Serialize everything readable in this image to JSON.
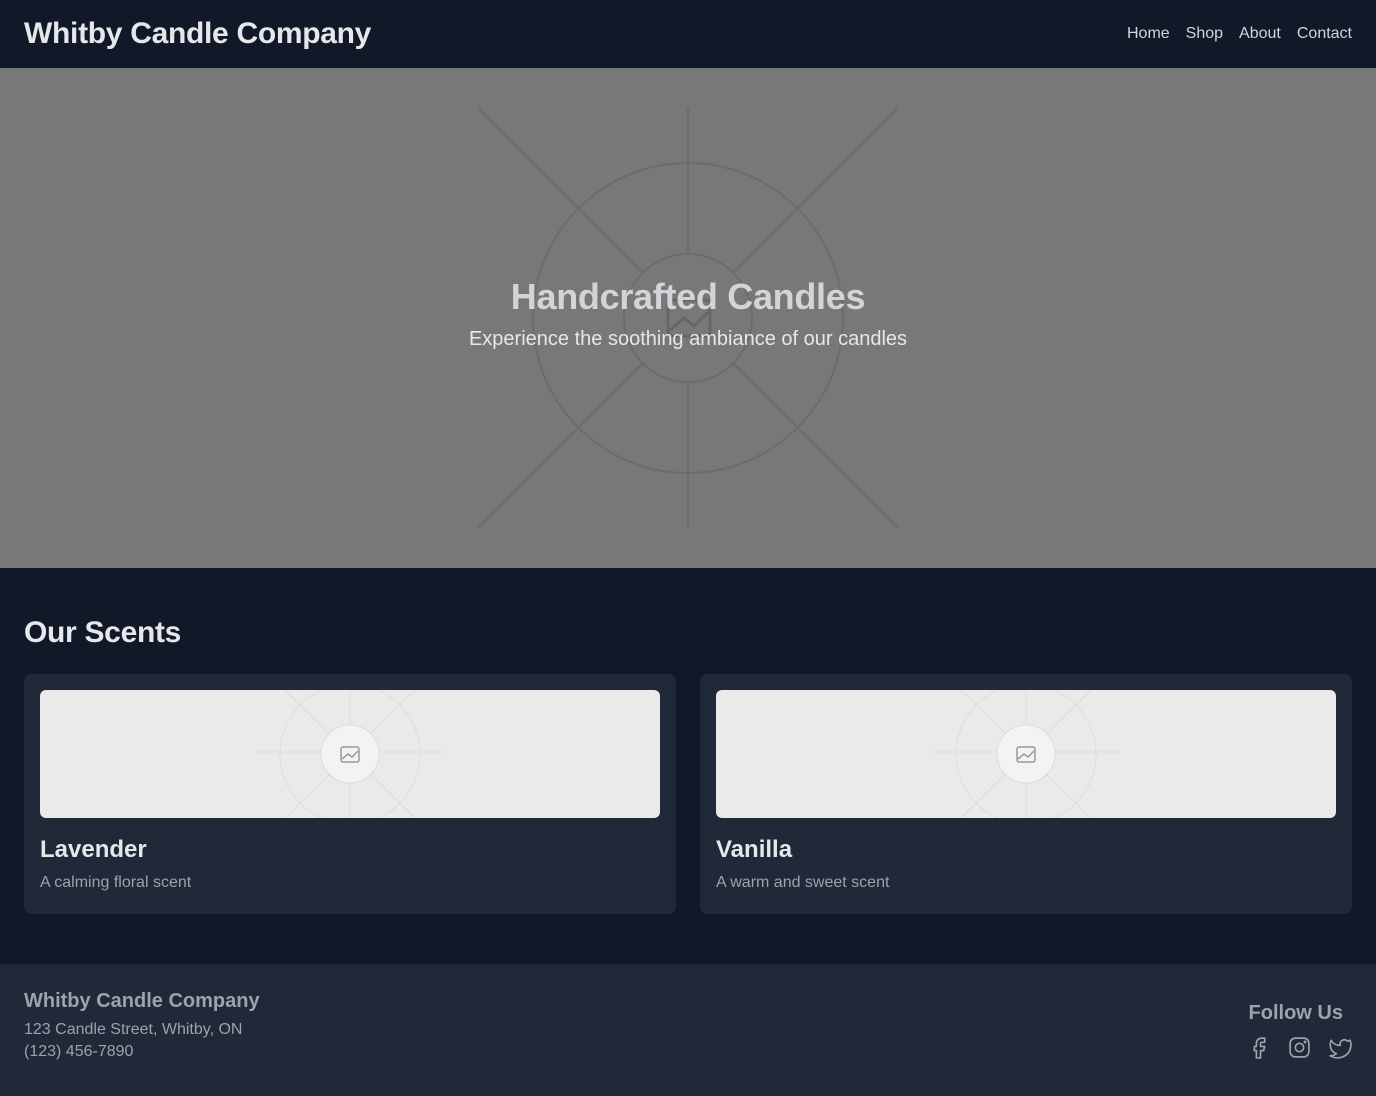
{
  "header": {
    "brand": "Whitby Candle Company",
    "nav": [
      "Home",
      "Shop",
      "About",
      "Contact"
    ]
  },
  "hero": {
    "title": "Handcrafted Candles",
    "subtitle": "Experience the soothing ambiance of our candles",
    "image_icon": "image-placeholder-icon"
  },
  "scents": {
    "title": "Our Scents",
    "items": [
      {
        "name": "Lavender",
        "description": "A calming floral scent",
        "image_icon": "image-placeholder-icon"
      },
      {
        "name": "Vanilla",
        "description": "A warm and sweet scent",
        "image_icon": "image-placeholder-icon"
      }
    ]
  },
  "footer": {
    "brand": "Whitby Candle Company",
    "address": "123 Candle Street, Whitby, ON",
    "phone": "(123) 456-7890",
    "follow_title": "Follow Us",
    "social_icons": [
      "facebook-icon",
      "instagram-icon",
      "twitter-icon"
    ]
  },
  "colors": {
    "background": "#111827",
    "surface": "#1f2937",
    "hero_placeholder": "#787878",
    "text": "#e5e7eb",
    "muted_text": "#9ca3af"
  }
}
